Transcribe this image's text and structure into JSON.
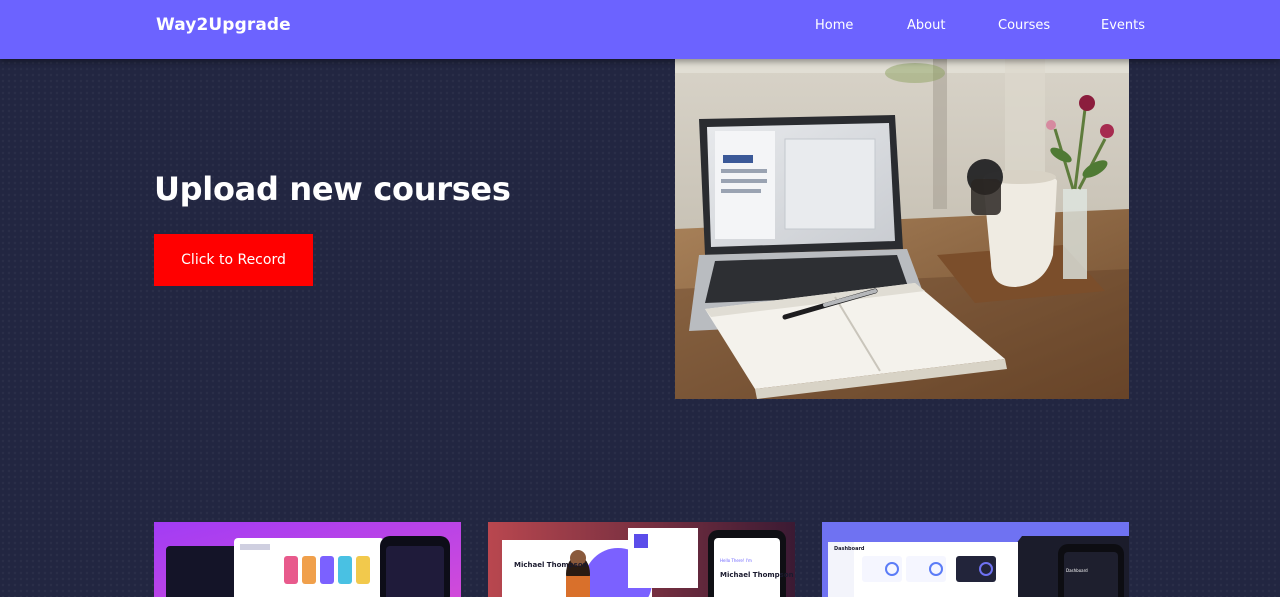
{
  "navbar": {
    "brand": "Way2Upgrade",
    "links": [
      "Home",
      "About",
      "Courses",
      "Events"
    ]
  },
  "hero": {
    "title": "Upload new courses",
    "button_label": "Click to Record",
    "image_icon": "laptop-notebook-photo"
  },
  "cards": [
    {
      "name": "social-app-preview",
      "icon": "mockup-thumbnail"
    },
    {
      "name": "portfolio-preview",
      "icon": "mockup-thumbnail",
      "person_name": "Michael Thompson",
      "greeting": "Hello There! I'm"
    },
    {
      "name": "dashboard-preview",
      "icon": "mockup-thumbnail",
      "title": "Dashboard"
    }
  ],
  "colors": {
    "navbar": "#6c63ff",
    "background": "#222641",
    "button": "#ff0000",
    "text": "#ffffff"
  }
}
